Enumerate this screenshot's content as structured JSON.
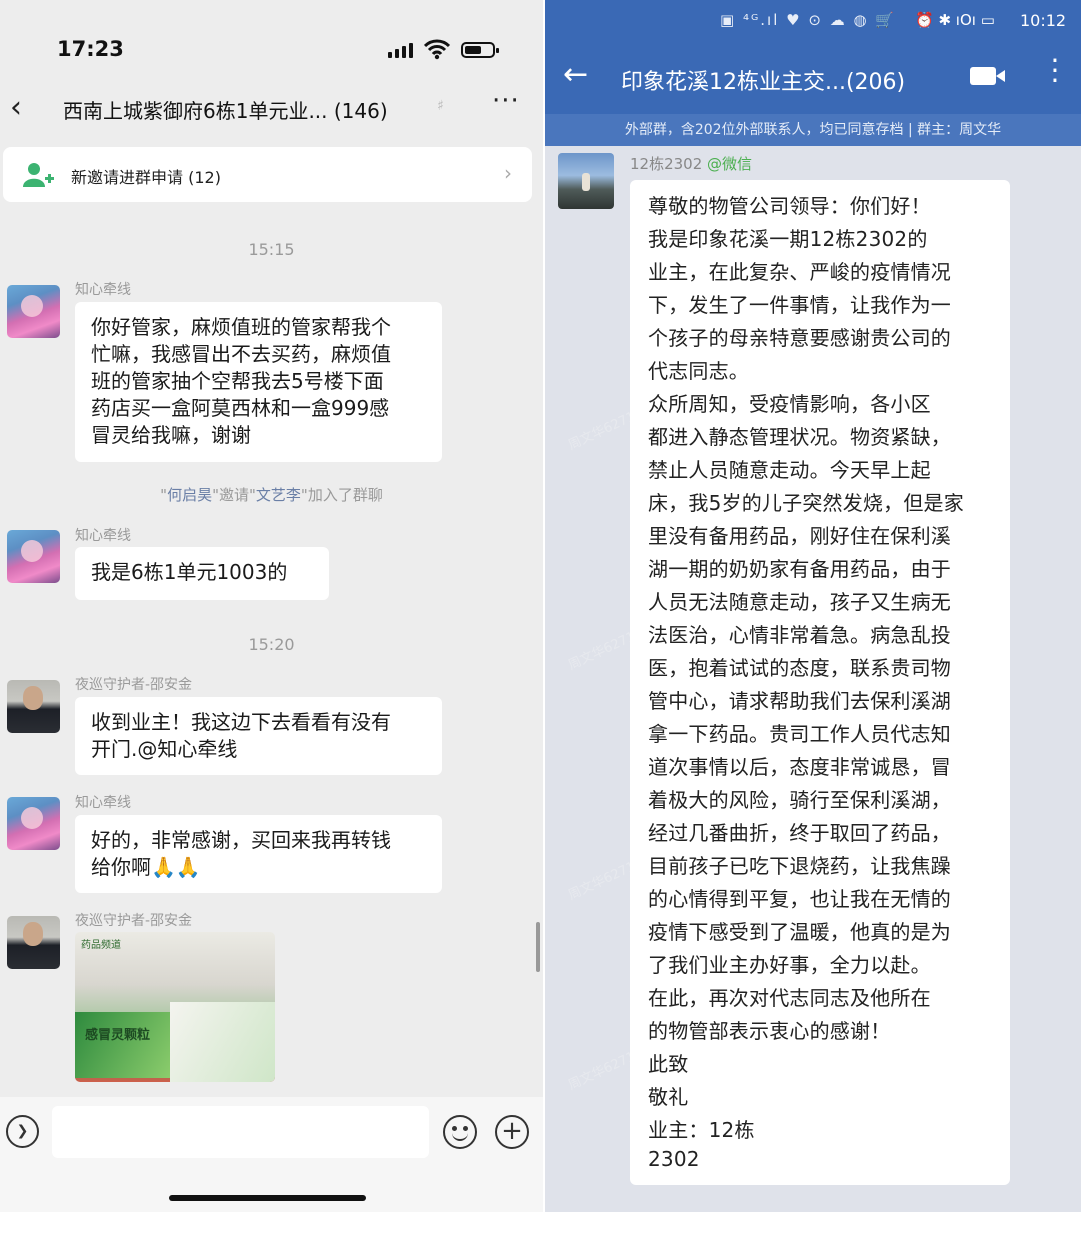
{
  "left": {
    "status_time": "17:23",
    "group_title": "西南上城紫御府6栋1单元业... (146)",
    "back_icon": "back-chevron-icon",
    "more_label": "···",
    "invite_banner": "新邀请进群申请 (12)",
    "timestamps": [
      "15:15",
      "15:20"
    ],
    "system_message": {
      "prefix": "\"",
      "inviter": "何启昊",
      "middle": "\"邀请\"",
      "invitee": "文艺李",
      "suffix": "\"加入了群聊"
    },
    "messages": [
      {
        "sender": "知心牵线",
        "lines": [
          "你好管家，麻烦值班的管家帮我个",
          "忙嘛，我感冒出不去买药，麻烦值",
          "班的管家抽个空帮我去5号楼下面",
          "药店买一盒阿莫西林和一盒999感",
          "冒灵给我嘛，谢谢"
        ]
      },
      {
        "sender": "知心牵线",
        "lines": [
          "我是6栋1单元1003的"
        ]
      },
      {
        "sender": "夜巡守护者-邵安金",
        "lines": [
          "收到业主！我这边下去看看有没有",
          "开门.@知心牵线"
        ]
      },
      {
        "sender": "知心牵线",
        "lines": [
          "好的，非常感谢，买回来我再转钱",
          "给你啊🙏🙏"
        ]
      },
      {
        "sender": "夜巡守护者-邵安金",
        "image_caption": "感冒灵颗粒",
        "image_header": "药品频道"
      }
    ]
  },
  "right": {
    "status_time": "10:12",
    "status_icons": "▣ ⁴ᴳ.ıl ♥ ⊙ ☁ ◍ 🛒",
    "status_right": "⏰ ✱ ıOı ▭",
    "group_title": "印象花溪12栋业主交...(206)",
    "subtitle": "外部群，含202位外部联系人，均已同意存档 | 群主：周文华",
    "sender": "12栋2302",
    "sender_source": "@微信",
    "letter_lines": [
      "尊敬的物管公司领导：你们好！",
      "  我是印象花溪一期12栋2302的",
      "业主，在此复杂、严峻的疫情情况",
      "下，发生了一件事情，让我作为一",
      "个孩子的母亲特意要感谢贵公司的",
      "代志同志。",
      "  众所周知，受疫情影响，各小区",
      "都进入静态管理状况。物资紧缺，",
      "禁止人员随意走动。今天早上起",
      "床，我5岁的儿子突然发烧，但是家",
      "里没有备用药品，刚好住在保利溪",
      "湖一期的奶奶家有备用药品，由于",
      "人员无法随意走动，孩子又生病无",
      "法医治，心情非常着急。病急乱投",
      "医，抱着试试的态度，联系贵司物",
      "管中心，请求帮助我们去保利溪湖",
      "拿一下药品。贵司工作人员代志知",
      "道次事情以后，态度非常诚恳，冒",
      "着极大的风险，骑行至保利溪湖，",
      "经过几番曲折，终于取回了药品，",
      "目前孩子已吃下退烧药，让我焦躁",
      "的心情得到平复，也让我在无情的",
      "疫情下感受到了温暖，他真的是为",
      "了我们业主办好事，全力以赴。",
      "  在此，再次对代志同志及他所在",
      "的物管部表示衷心的感谢！",
      " 此致",
      "    敬礼",
      "                        业主：12栋",
      "2302"
    ]
  }
}
